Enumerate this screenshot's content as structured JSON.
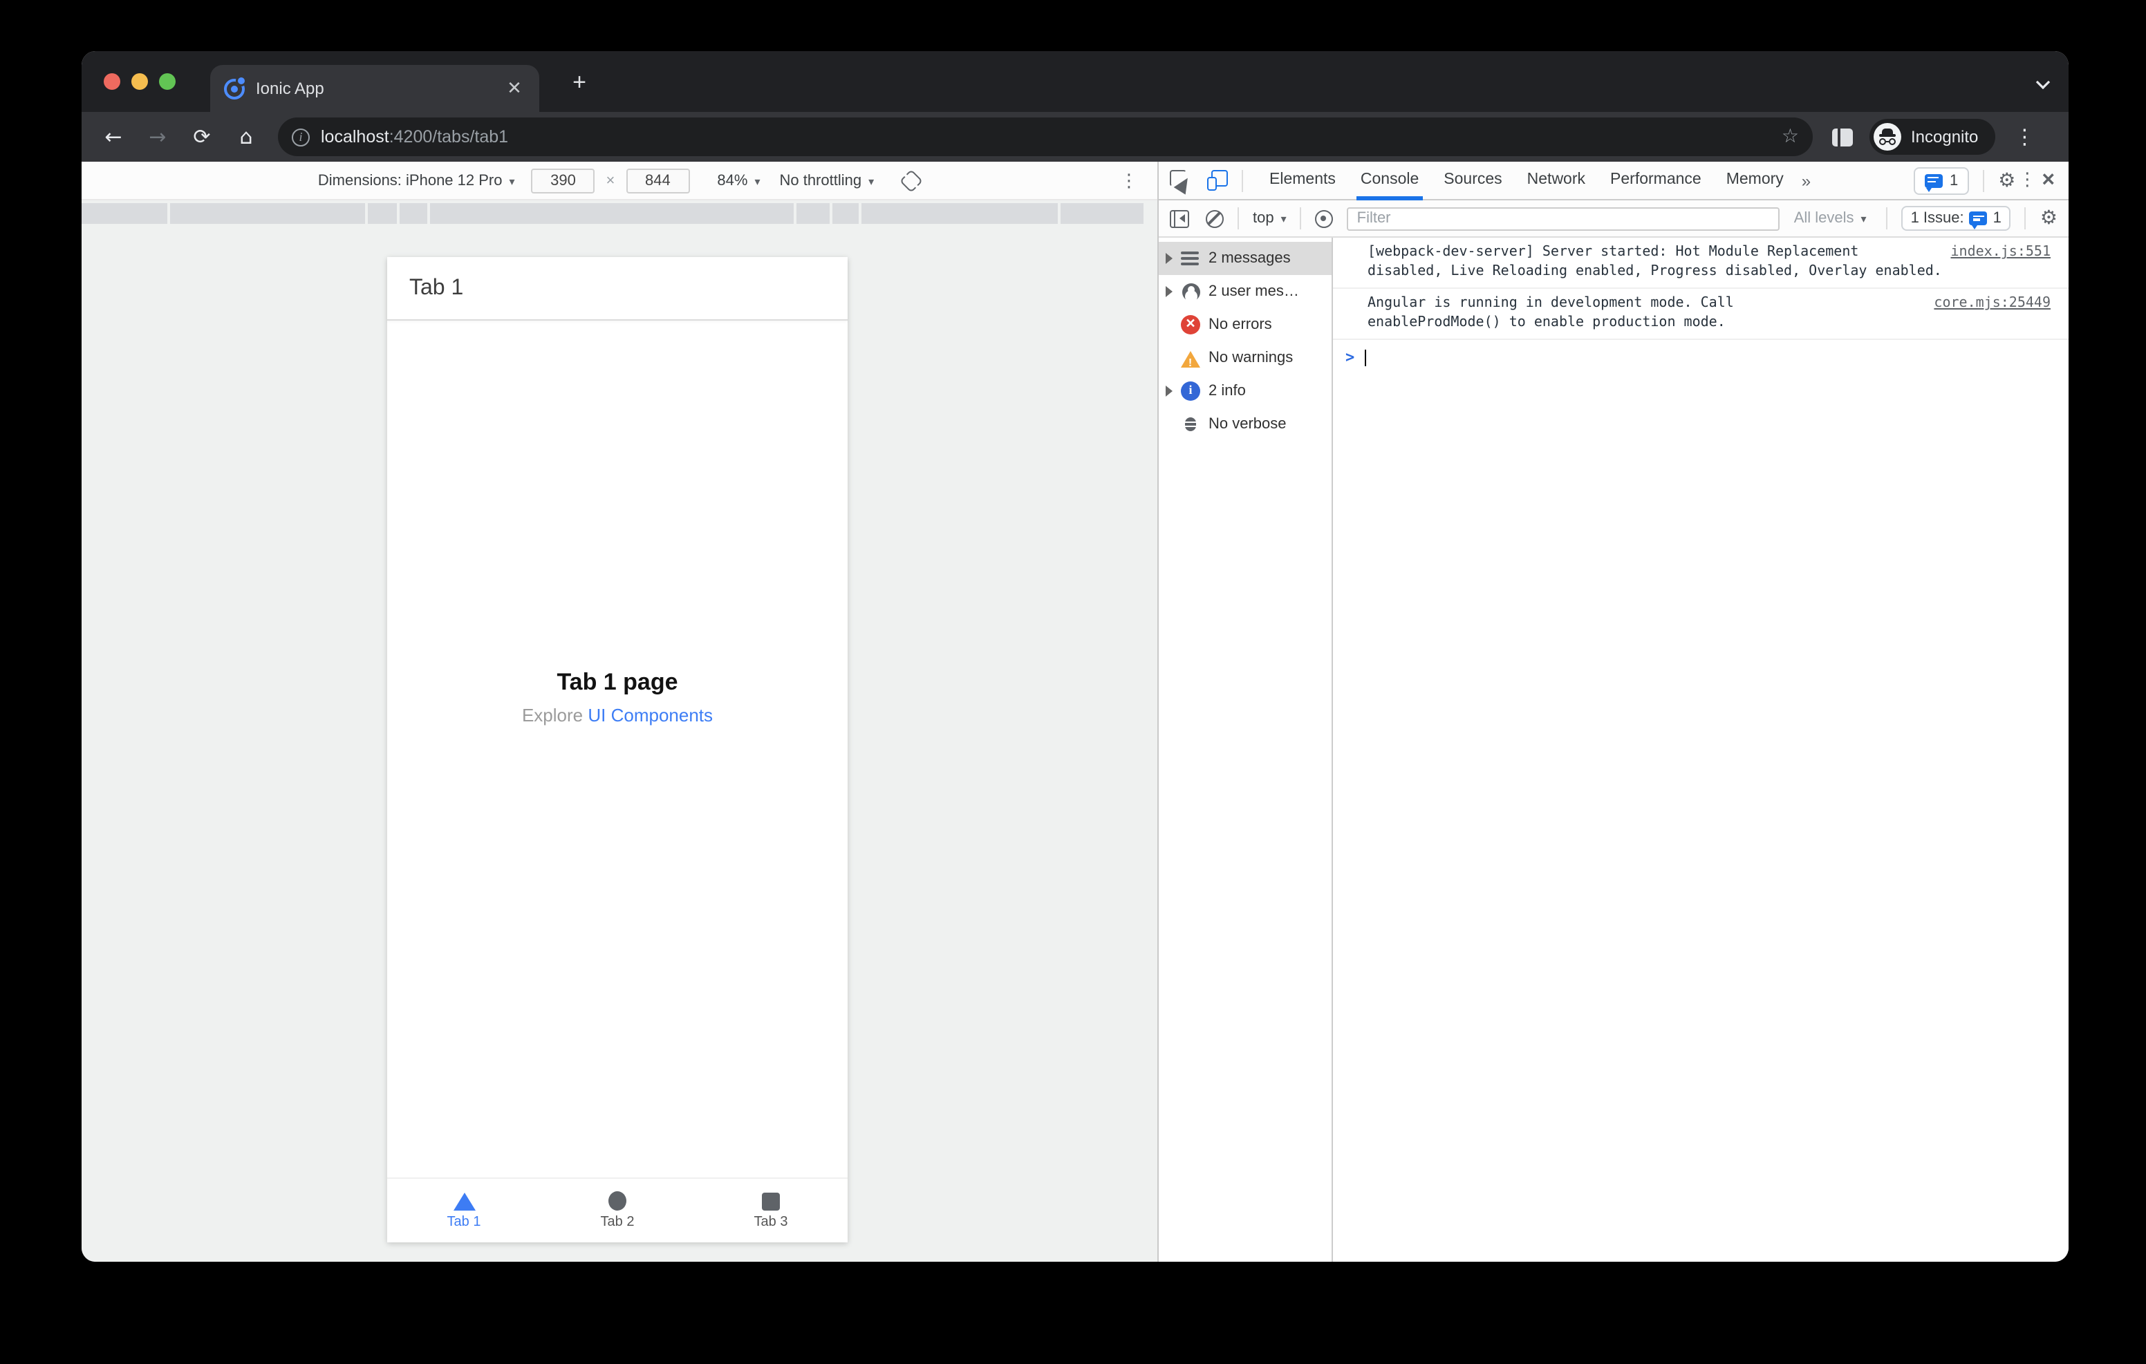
{
  "window": {
    "tab_title": "Ionic App",
    "url_host": "localhost",
    "url_path": ":4200/tabs/tab1",
    "incognito_label": "Incognito"
  },
  "icons": {
    "back": "←",
    "forward": "→",
    "reload": "⟳",
    "home": "⌂",
    "star": "☆",
    "more_tabs": "»",
    "menu": "⋮",
    "close": "×",
    "gear": "⚙",
    "new_tab": "+",
    "tab_close": "✕",
    "info": "i",
    "caret": "▾",
    "error_x": "✕",
    "info_i": "i",
    "warn_bang": "!"
  },
  "device_toolbar": {
    "dimensions_label": "Dimensions: iPhone 12 Pro",
    "width_value": "390",
    "times": "×",
    "height_value": "844",
    "zoom_value": "84%",
    "throttling_value": "No throttling"
  },
  "devtools": {
    "tabs": [
      {
        "label": "Elements"
      },
      {
        "label": "Console"
      },
      {
        "label": "Sources"
      },
      {
        "label": "Network"
      },
      {
        "label": "Performance"
      },
      {
        "label": "Memory"
      }
    ],
    "top_issue_count": "1",
    "console_toolbar": {
      "context": "top",
      "filter_placeholder": "Filter",
      "levels": "All levels",
      "issue_label": "1 Issue:",
      "issue_count": "1"
    },
    "sidebar": [
      {
        "label": "2 messages"
      },
      {
        "label": "2 user mes…"
      },
      {
        "label": "No errors"
      },
      {
        "label": "No warnings"
      },
      {
        "label": "2 info"
      },
      {
        "label": "No verbose"
      }
    ],
    "messages": [
      {
        "text": "[webpack-dev-server] Server started: Hot Module Replacement\ndisabled, Live Reloading enabled, Progress disabled, Overlay enabled.",
        "source": "index.js:551"
      },
      {
        "text": "Angular is running in development mode. Call\nenableProdMode() to enable production mode.",
        "source": "core.mjs:25449"
      }
    ],
    "prompt_chevron": ">"
  },
  "app": {
    "header_title": "Tab 1",
    "page_title": "Tab 1 page",
    "subtitle_prefix": "Explore ",
    "subtitle_link": "UI Components",
    "tabs": [
      {
        "label": "Tab 1"
      },
      {
        "label": "Tab 2"
      },
      {
        "label": "Tab 3"
      }
    ]
  },
  "colors": {
    "accent_blue": "#1a73e8",
    "ionic_blue": "#3d7cf4",
    "frame_dark": "#202124",
    "toolbar_dark": "#35363a",
    "error_red": "#df4337",
    "warning_yellow": "#f2a73d",
    "info_blue": "#3367d6"
  }
}
